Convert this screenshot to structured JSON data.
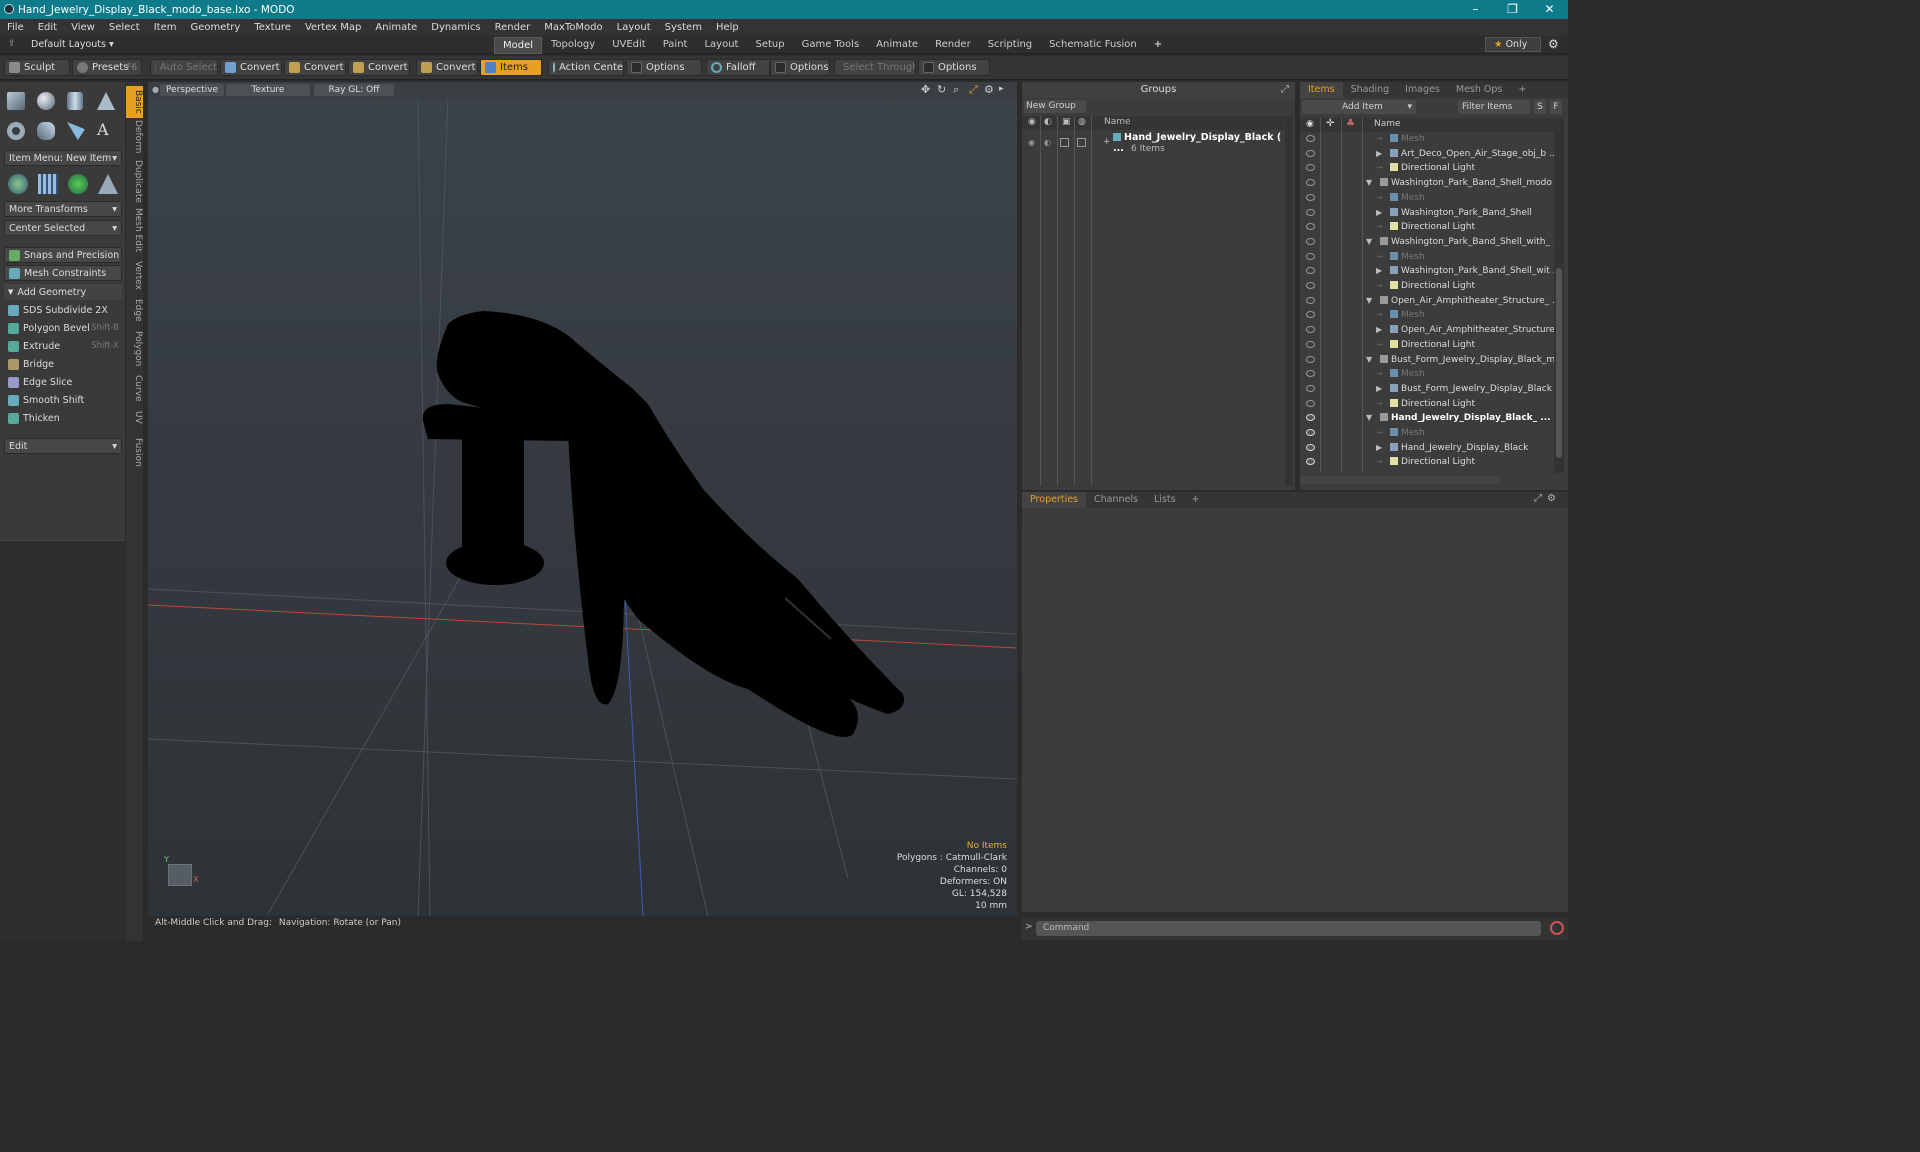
{
  "window": {
    "title": "Hand_Jewelry_Display_Black_modo_base.lxo - MODO",
    "controls": [
      "–",
      "❐",
      "✕"
    ]
  },
  "menubar": [
    "File",
    "Edit",
    "View",
    "Select",
    "Item",
    "Geometry",
    "Texture",
    "Vertex Map",
    "Animate",
    "Dynamics",
    "Render",
    "MaxToModo",
    "Layout",
    "System",
    "Help"
  ],
  "layoutbar": {
    "layouts_label": "Default Layouts",
    "tabs": [
      "Model",
      "Topology",
      "UVEdit",
      "Paint",
      "Layout",
      "Setup",
      "Game Tools",
      "Animate",
      "Render",
      "Scripting",
      "Schematic Fusion"
    ],
    "active_tab": "Model",
    "add_tab": "+",
    "only_label": "Only"
  },
  "toolbar": {
    "sculpt": "Sculpt",
    "presets": "Presets",
    "presets_shortcut": "F6",
    "auto_select": "Auto Select",
    "convert": "Convert",
    "items": "Items",
    "action_center": "Action Center",
    "options": "Options",
    "falloff": "Falloff",
    "select_through": "Select Through"
  },
  "left_panel": {
    "item_menu": "Item Menu: New Item",
    "more_transforms": "More Transforms",
    "center_selected": "Center Selected",
    "snaps": "Snaps and Precision",
    "mesh_constraints": "Mesh Constraints",
    "add_geometry": "Add Geometry",
    "tools": [
      {
        "label": "SDS Subdivide 2X",
        "shortcut": ""
      },
      {
        "label": "Polygon Bevel",
        "shortcut": "Shift-B"
      },
      {
        "label": "Extrude",
        "shortcut": "Shift-X"
      },
      {
        "label": "Bridge",
        "shortcut": ""
      },
      {
        "label": "Edge Slice",
        "shortcut": ""
      },
      {
        "label": "Smooth Shift",
        "shortcut": ""
      },
      {
        "label": "Thicken",
        "shortcut": ""
      }
    ],
    "edit_dropdown": "Edit"
  },
  "vertical_tabs": [
    "Basic",
    "Deform",
    "Duplicate",
    "Mesh Edit",
    "Vertex",
    "Edge",
    "Polygon",
    "Curve",
    "UV",
    "Fusion"
  ],
  "viewport": {
    "view_mode": "Perspective",
    "shading": "Texture",
    "raygl": "Ray GL: Off",
    "info": {
      "selection": "No Items",
      "polygons": "Polygons : Catmull-Clark",
      "channels": "Channels: 0",
      "deformers": "Deformers: ON",
      "gl": "GL: 154,528",
      "scale": "10 mm"
    }
  },
  "status_bar": {
    "hint_key": "Alt-Middle Click and Drag:",
    "hint_action": "Navigation: Rotate (or Pan)"
  },
  "groups_panel": {
    "title": "Groups",
    "new_group": "New Group",
    "column_name": "Name",
    "group_name": "Hand_Jewelry_Display_Black",
    "group_count": "6 Items"
  },
  "items_panel": {
    "tabs": [
      "Items",
      "Shading",
      "Images",
      "Mesh Ops"
    ],
    "add_item": "Add Item",
    "filter_items": "Filter Items",
    "filter_s": "S",
    "filter_f": "F",
    "column_name": "Name",
    "rows": [
      {
        "label": "Mesh",
        "kind": "mesh",
        "level": 2,
        "expander": ""
      },
      {
        "label": "Art_Deco_Open_Air_Stage_obj_b ...",
        "kind": "item",
        "level": 2,
        "expander": "▶"
      },
      {
        "label": "Directional Light",
        "kind": "light",
        "level": 2,
        "expander": ""
      },
      {
        "label": "Washington_Park_Band_Shell_modo ...",
        "kind": "scene",
        "level": 1,
        "expander": "▼"
      },
      {
        "label": "Mesh",
        "kind": "mesh",
        "level": 2,
        "expander": ""
      },
      {
        "label": "Washington_Park_Band_Shell",
        "kind": "item",
        "level": 2,
        "expander": "▶"
      },
      {
        "label": "Directional Light",
        "kind": "light",
        "level": 2,
        "expander": ""
      },
      {
        "label": "Washington_Park_Band_Shell_with_ ...",
        "kind": "scene",
        "level": 1,
        "expander": "▼"
      },
      {
        "label": "Mesh",
        "kind": "mesh",
        "level": 2,
        "expander": ""
      },
      {
        "label": "Washington_Park_Band_Shell_wit ...",
        "kind": "item",
        "level": 2,
        "expander": "▶"
      },
      {
        "label": "Directional Light",
        "kind": "light",
        "level": 2,
        "expander": ""
      },
      {
        "label": "Open_Air_Amphitheater_Structure_ ...",
        "kind": "scene",
        "level": 1,
        "expander": "▼"
      },
      {
        "label": "Mesh",
        "kind": "mesh",
        "level": 2,
        "expander": ""
      },
      {
        "label": "Open_Air_Amphitheater_Structure...",
        "kind": "item",
        "level": 2,
        "expander": "▶"
      },
      {
        "label": "Directional Light",
        "kind": "light",
        "level": 2,
        "expander": ""
      },
      {
        "label": "Bust_Form_Jewelry_Display_Black_m...",
        "kind": "scene",
        "level": 1,
        "expander": "▼"
      },
      {
        "label": "Mesh",
        "kind": "mesh",
        "level": 2,
        "expander": ""
      },
      {
        "label": "Bust_Form_Jewelry_Display_Black",
        "kind": "item",
        "level": 2,
        "expander": "▶"
      },
      {
        "label": "Directional Light",
        "kind": "light",
        "level": 2,
        "expander": ""
      },
      {
        "label": "Hand_Jewelry_Display_Black_ ...",
        "kind": "scene-bold",
        "level": 1,
        "expander": "▼"
      },
      {
        "label": "Mesh",
        "kind": "mesh",
        "level": 2,
        "expander": ""
      },
      {
        "label": "Hand_Jewelry_Display_Black",
        "kind": "item",
        "level": 2,
        "expander": "▶"
      },
      {
        "label": "Directional Light",
        "kind": "light",
        "level": 2,
        "expander": ""
      }
    ]
  },
  "properties_panel": {
    "tabs": [
      "Properties",
      "Channels",
      "Lists"
    ],
    "add": "+"
  },
  "command": {
    "placeholder": "Command",
    "prompt": ">"
  },
  "colors": {
    "accent": "#e8a020",
    "titlebar": "#0e7a8a",
    "panel": "#3c3c3c"
  }
}
